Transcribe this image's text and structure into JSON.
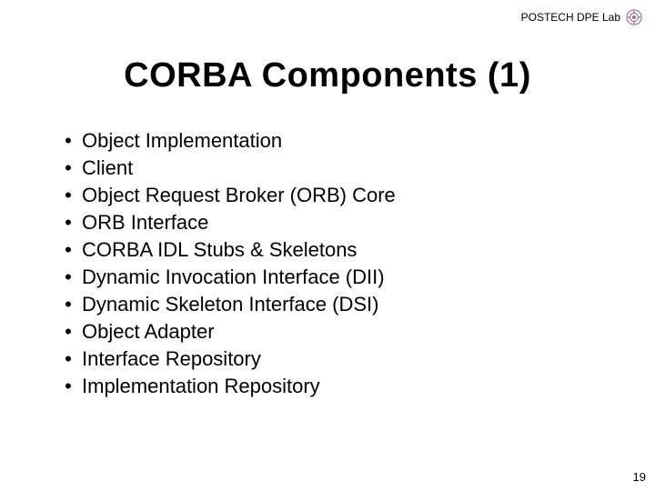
{
  "header": {
    "lab": "POSTECH DPE Lab"
  },
  "title": "CORBA Components (1)",
  "bullet": "•",
  "items": [
    "Object Implementation",
    "Client",
    "Object Request Broker (ORB) Core",
    "ORB Interface",
    "CORBA IDL Stubs & Skeletons",
    "Dynamic Invocation Interface (DII)",
    "Dynamic Skeleton Interface (DSI)",
    "Object Adapter",
    "Interface Repository",
    "Implementation Repository"
  ],
  "page_number": "19"
}
